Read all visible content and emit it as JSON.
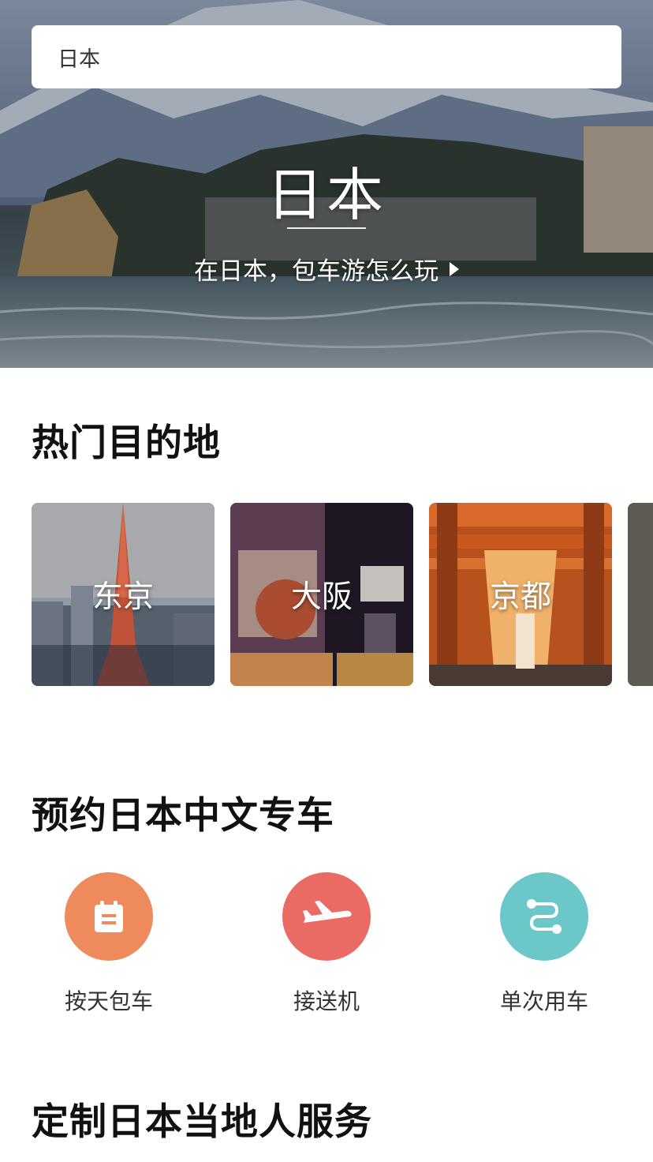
{
  "search": {
    "value": "日本"
  },
  "hero": {
    "title": "日本",
    "link_label": "在日本，包车游怎么玩"
  },
  "sections": {
    "popular": "热门目的地",
    "booking": "预约日本中文专车",
    "custom": "定制日本当地人服务"
  },
  "destinations": [
    {
      "name": "东京",
      "icon": "tokyo-tower-photo"
    },
    {
      "name": "大阪",
      "icon": "osaka-street-photo"
    },
    {
      "name": "京都",
      "icon": "kyoto-torii-photo"
    }
  ],
  "services": [
    {
      "label": "按天包车",
      "icon": "calendar-icon",
      "color": "#ee8a5c"
    },
    {
      "label": "接送机",
      "icon": "airplane-icon",
      "color": "#ea6b63"
    },
    {
      "label": "单次用车",
      "icon": "route-icon",
      "color": "#6cc8c8"
    }
  ]
}
